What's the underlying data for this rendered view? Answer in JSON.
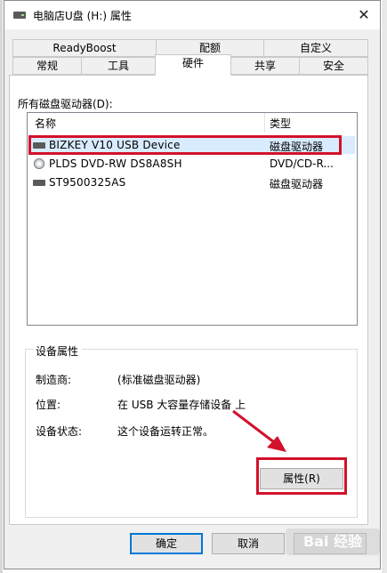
{
  "window": {
    "title": "电脑店U盘 (H:) 属性",
    "close_glyph": "✕"
  },
  "tabs_top": [
    "ReadyBoost",
    "配额",
    "自定义"
  ],
  "tabs_bottom": [
    "常规",
    "工具",
    "硬件",
    "共享",
    "安全"
  ],
  "active_tab": "硬件",
  "drives": {
    "label": "所有磁盘驱动器(D):",
    "columns": [
      "名称",
      "类型"
    ],
    "rows": [
      {
        "name": "BIZKEY V10 USB Device",
        "type": "磁盘驱动器",
        "icon": "drive-icon",
        "selected": true
      },
      {
        "name": "PLDS DVD-RW DS8A8SH",
        "type": "DVD/CD-R...",
        "icon": "dvd-icon",
        "selected": false
      },
      {
        "name": "ST9500325AS",
        "type": "磁盘驱动器",
        "icon": "drive-icon",
        "selected": false
      }
    ]
  },
  "device_props": {
    "title": "设备属性",
    "manufacturer_label": "制造商:",
    "manufacturer_value": "(标准磁盘驱动器)",
    "location_label": "位置:",
    "location_value": "在 USB 大容量存储设备 上",
    "status_label": "设备状态:",
    "status_value": "这个设备运转正常。",
    "properties_button": "属性(R)"
  },
  "buttons": {
    "ok": "确定",
    "cancel": "取消"
  },
  "background": {
    "left_text_1": "",
    "left_text_2": ""
  },
  "watermark": "Bai 经验",
  "colors": {
    "annotation_red": "#d3112a",
    "selection": "#d9ecff",
    "accent": "#0078d7"
  }
}
